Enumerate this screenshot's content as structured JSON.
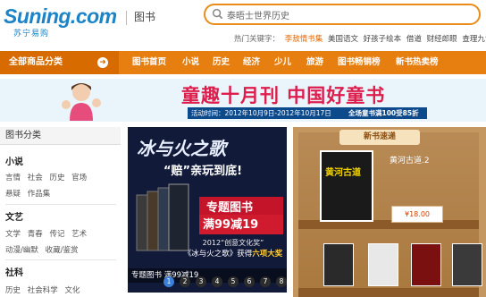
{
  "header": {
    "logo_text": "Suning.com",
    "logo_sub": "苏宁易购",
    "category": "图书",
    "search_placeholder": "泰晤士世界历史",
    "hot_label": "热门关键字：",
    "hot_keywords": [
      "李敖情书集",
      "美国语文",
      "好孩子绘本",
      "借道",
      "财经郎眼",
      "查理九世"
    ]
  },
  "nav": {
    "all_categories": "全部商品分类",
    "items": [
      "图书首页",
      "小说",
      "历史",
      "经济",
      "少儿",
      "旅游",
      "图书畅销榜",
      "新书热卖榜"
    ]
  },
  "banner": {
    "title": "童趣十月刊 中国好童书",
    "date": "活动时间：2012年10月9日-2012年10月17日",
    "promo": "全场童书满100受85折"
  },
  "sidebar": {
    "heading": "图书分类",
    "sections": [
      {
        "title": "小说",
        "rows": [
          [
            "言情",
            "社会",
            "历史",
            "官场"
          ],
          [
            "悬疑",
            "作品集"
          ]
        ]
      },
      {
        "title": "文艺",
        "rows": [
          [
            "文学",
            "青春",
            "传记",
            "艺术"
          ],
          [
            "动漫/幽默",
            "收藏/鉴赏"
          ]
        ]
      },
      {
        "title": "社科",
        "rows": [
          [
            "历史",
            "社会科学",
            "文化"
          ]
        ]
      }
    ]
  },
  "promo": {
    "headline": "冰与火之歌",
    "tagline": "“赔”亲玩到底!",
    "topic_1": "专题图书",
    "topic_2": "满99减19",
    "award_1": "2012“创意文化奖”",
    "award_2_a": "《冰与火之歌》获得",
    "award_2_b": "六项大奖",
    "caption": "专题图书 满99减19",
    "slides": [
      "1",
      "2",
      "3",
      "4",
      "5",
      "6",
      "7",
      "8"
    ],
    "active_slide": "1"
  },
  "shelf": {
    "header": "新书速递",
    "featured_title": "黄河古道.2",
    "featured_cover": "黄河古道",
    "price": "¥18.00"
  },
  "colors": {
    "brand_blue": "#1c84c6",
    "nav_orange": "#e77e10",
    "banner_red": "#dd1e4c"
  }
}
